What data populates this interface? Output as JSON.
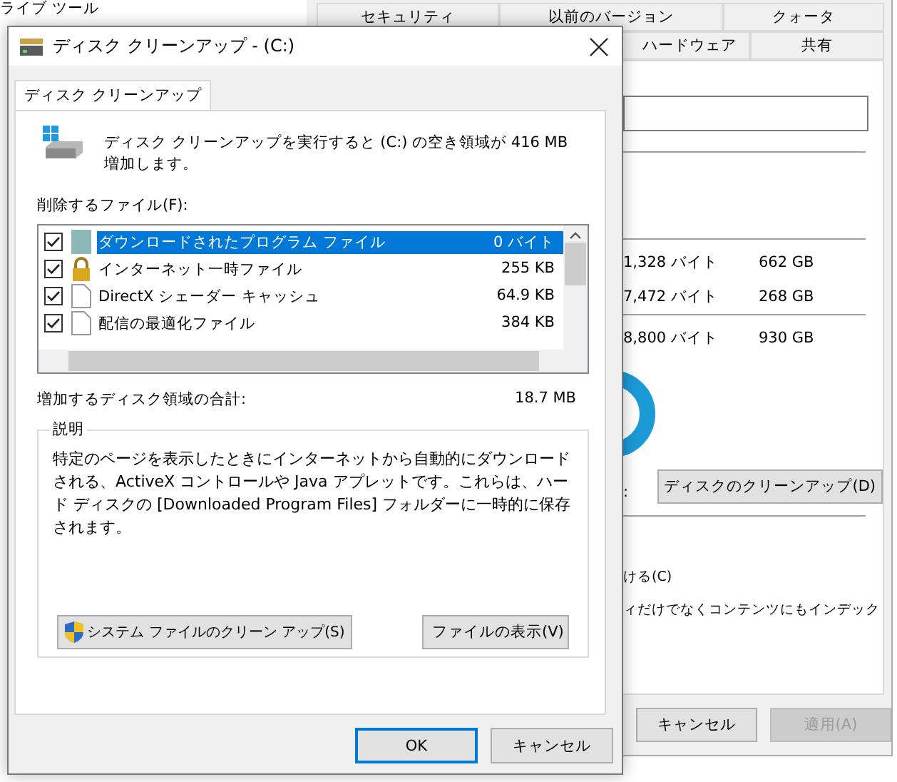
{
  "explorer": {
    "ribbon_tab": "ライブ ツール"
  },
  "properties": {
    "tabs_top": [
      {
        "label": "セキュリティ",
        "selected": false
      },
      {
        "label": "以前のバージョン",
        "selected": false
      },
      {
        "label": "クォータ",
        "selected": false
      }
    ],
    "tabs_bottom": [
      {
        "label": "ハードウェア",
        "selected": false
      },
      {
        "label": "共有",
        "selected": false
      }
    ],
    "usage": [
      {
        "bytes": "1,328 バイト",
        "size": "662 GB"
      },
      {
        "bytes": "7,472 バイト",
        "size": "268 GB"
      },
      {
        "bytes": "8,800 バイト",
        "size": "930 GB"
      }
    ],
    "drive_label": ":",
    "cleanup_button": "ディスクのクリーンアップ(D)",
    "options": [
      "ける(C)",
      "ィだけでなくコンテンツにもインデック"
    ],
    "buttons": [
      {
        "label": "キャンセル",
        "disabled": false
      },
      {
        "label": "適用(A)",
        "disabled": true
      }
    ]
  },
  "dialog": {
    "title": "ディスク クリーンアップ - (C:)",
    "tabs": [
      {
        "label": "ディスク クリーンアップ",
        "selected": true
      }
    ],
    "summary": "ディスク クリーンアップを実行すると (C:) の空き領域が 416 MB 増加します。",
    "files_label": "削除するファイル(F):",
    "files": [
      {
        "name": "ダウンロードされたプログラム ファイル",
        "size": "0 バイト",
        "checked": true,
        "selected": true,
        "kind": "program"
      },
      {
        "name": "インターネット一時ファイル",
        "size": "255 KB",
        "checked": true,
        "selected": false,
        "kind": "lock"
      },
      {
        "name": "DirectX シェーダー キャッシュ",
        "size": "64.9 KB",
        "checked": true,
        "selected": false,
        "kind": "document"
      },
      {
        "name": "配信の最適化ファイル",
        "size": "384 KB",
        "checked": true,
        "selected": false,
        "kind": "document"
      }
    ],
    "total_label": "増加するディスク領域の合計:",
    "total_value": "18.7 MB",
    "description_title": "説明",
    "description": "特定のページを表示したときにインターネットから自動的にダウンロードされる、ActiveX コントロールや Java アプレットです。これらは、ハード ディスクの [Downloaded Program Files] フォルダーに一時的に保存されます。",
    "system_button": "システム ファイルのクリーン アップ(S)",
    "view_button": "ファイルの表示(V)",
    "buttons": [
      {
        "label": "OK",
        "default": true
      },
      {
        "label": "キャンセル",
        "default": false
      }
    ]
  }
}
